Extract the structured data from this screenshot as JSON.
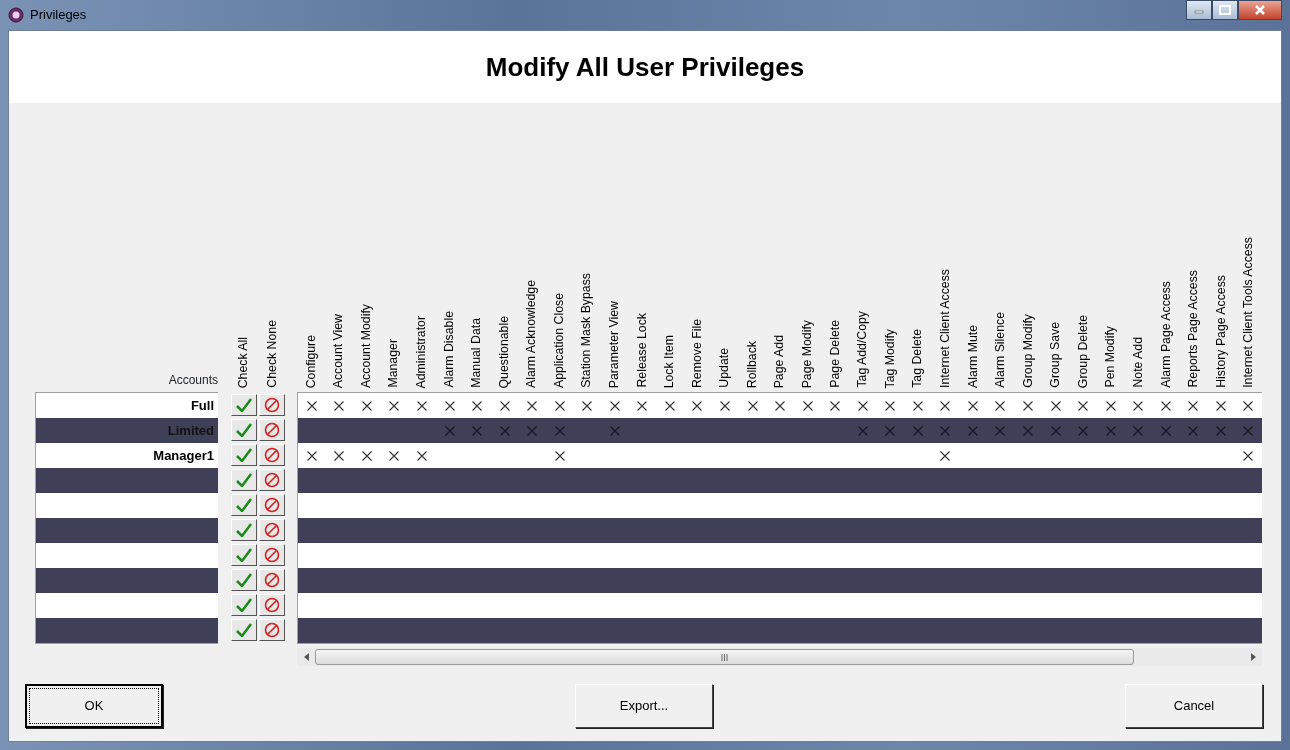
{
  "window": {
    "title": "Privileges"
  },
  "heading": "Modify All User Privileges",
  "accounts_label": "Accounts",
  "check_columns": [
    "Check All",
    "Check None"
  ],
  "privilege_columns": [
    "Configure",
    "Account View",
    "Account Modify",
    "Manager",
    "Administrator",
    "Alarm Disable",
    "Manual Data",
    "Questionable",
    "Alarm Acknowledge",
    "Application Close",
    "Station Mask Bypass",
    "Parameter View",
    "Release Lock",
    "Lock Item",
    "Remove File",
    "Update",
    "Rollback",
    "Page Add",
    "Page Modify",
    "Page Delete",
    "Tag Add/Copy",
    "Tag Modify",
    "Tag Delete",
    "Internet Client Access",
    "Alarm Mute",
    "Alarm Silence",
    "Group Modify",
    "Group Save",
    "Group Delete",
    "Pen Modify",
    "Note Add",
    "Alarm Page Access",
    "Reports Page Access",
    "History Page Access",
    "Internet Client Tools Access"
  ],
  "rows": [
    {
      "account": "Full",
      "privileges": [
        true,
        true,
        true,
        true,
        true,
        true,
        true,
        true,
        true,
        true,
        true,
        true,
        true,
        true,
        true,
        true,
        true,
        true,
        true,
        true,
        true,
        true,
        true,
        true,
        true,
        true,
        true,
        true,
        true,
        true,
        true,
        true,
        true,
        true,
        true
      ]
    },
    {
      "account": "Limited",
      "privileges": [
        false,
        false,
        false,
        false,
        false,
        true,
        true,
        true,
        true,
        true,
        false,
        true,
        false,
        false,
        false,
        false,
        false,
        false,
        false,
        false,
        true,
        true,
        true,
        true,
        true,
        true,
        true,
        true,
        true,
        true,
        true,
        true,
        true,
        true,
        true
      ]
    },
    {
      "account": "Manager1",
      "privileges": [
        true,
        true,
        true,
        true,
        true,
        false,
        false,
        false,
        false,
        true,
        false,
        false,
        false,
        false,
        false,
        false,
        false,
        false,
        false,
        false,
        false,
        false,
        false,
        true,
        false,
        false,
        false,
        false,
        false,
        false,
        false,
        false,
        false,
        false,
        true
      ]
    },
    {
      "privileges": [
        false,
        false,
        false,
        false,
        false,
        false,
        false,
        false,
        false,
        false,
        false,
        false,
        false,
        false,
        false,
        false,
        false,
        false,
        false,
        false,
        false,
        false,
        false,
        false,
        false,
        false,
        false,
        false,
        false,
        false,
        false,
        false,
        false,
        false,
        false
      ]
    },
    {
      "privileges": [
        false,
        false,
        false,
        false,
        false,
        false,
        false,
        false,
        false,
        false,
        false,
        false,
        false,
        false,
        false,
        false,
        false,
        false,
        false,
        false,
        false,
        false,
        false,
        false,
        false,
        false,
        false,
        false,
        false,
        false,
        false,
        false,
        false,
        false,
        false
      ]
    },
    {
      "privileges": [
        false,
        false,
        false,
        false,
        false,
        false,
        false,
        false,
        false,
        false,
        false,
        false,
        false,
        false,
        false,
        false,
        false,
        false,
        false,
        false,
        false,
        false,
        false,
        false,
        false,
        false,
        false,
        false,
        false,
        false,
        false,
        false,
        false,
        false,
        false
      ]
    },
    {
      "privileges": [
        false,
        false,
        false,
        false,
        false,
        false,
        false,
        false,
        false,
        false,
        false,
        false,
        false,
        false,
        false,
        false,
        false,
        false,
        false,
        false,
        false,
        false,
        false,
        false,
        false,
        false,
        false,
        false,
        false,
        false,
        false,
        false,
        false,
        false,
        false
      ]
    },
    {
      "privileges": [
        false,
        false,
        false,
        false,
        false,
        false,
        false,
        false,
        false,
        false,
        false,
        false,
        false,
        false,
        false,
        false,
        false,
        false,
        false,
        false,
        false,
        false,
        false,
        false,
        false,
        false,
        false,
        false,
        false,
        false,
        false,
        false,
        false,
        false,
        false
      ]
    },
    {
      "privileges": [
        false,
        false,
        false,
        false,
        false,
        false,
        false,
        false,
        false,
        false,
        false,
        false,
        false,
        false,
        false,
        false,
        false,
        false,
        false,
        false,
        false,
        false,
        false,
        false,
        false,
        false,
        false,
        false,
        false,
        false,
        false,
        false,
        false,
        false,
        false
      ]
    },
    {
      "privileges": [
        false,
        false,
        false,
        false,
        false,
        false,
        false,
        false,
        false,
        false,
        false,
        false,
        false,
        false,
        false,
        false,
        false,
        false,
        false,
        false,
        false,
        false,
        false,
        false,
        false,
        false,
        false,
        false,
        false,
        false,
        false,
        false,
        false,
        false,
        false
      ]
    }
  ],
  "buttons": [
    "OK",
    "Export...",
    "Cancel"
  ]
}
